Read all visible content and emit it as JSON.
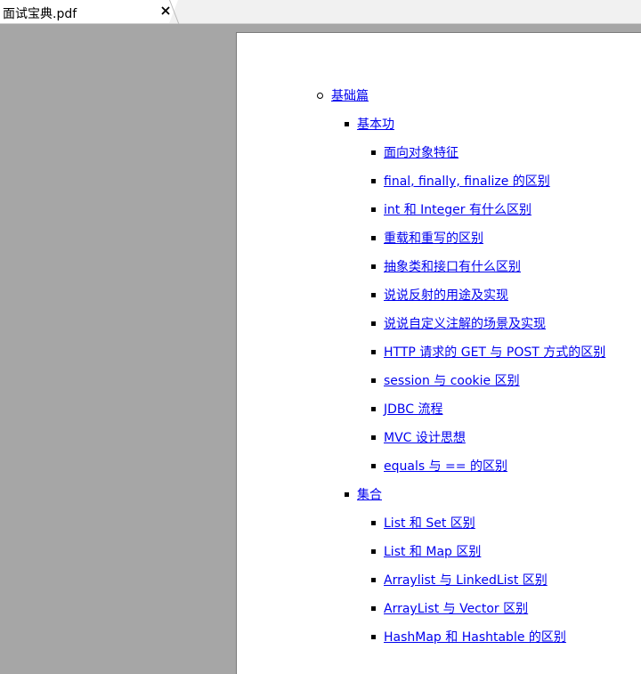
{
  "tab": {
    "title": "面试宝典.pdf",
    "close_icon": "close-icon"
  },
  "colors": {
    "viewer_background": "#a6a6a6",
    "link": "#0000ee"
  },
  "toc": {
    "section": "基础篇",
    "groups": [
      {
        "title": "基本功",
        "items": [
          "面向对象特征",
          "final, finally, finalize 的区别",
          "int 和 Integer 有什么区别",
          "重载和重写的区别",
          "抽象类和接口有什么区别",
          "说说反射的用途及实现",
          "说说自定义注解的场景及实现",
          "HTTP 请求的 GET 与 POST 方式的区别",
          "session 与 cookie 区别",
          "JDBC 流程",
          "MVC 设计思想",
          "equals 与 == 的区别"
        ]
      },
      {
        "title": "集合",
        "items": [
          "List 和 Set 区别",
          "List 和 Map 区别",
          "Arraylist 与 LinkedList 区别",
          "ArrayList 与 Vector 区别",
          "HashMap 和 Hashtable 的区别"
        ]
      }
    ]
  }
}
